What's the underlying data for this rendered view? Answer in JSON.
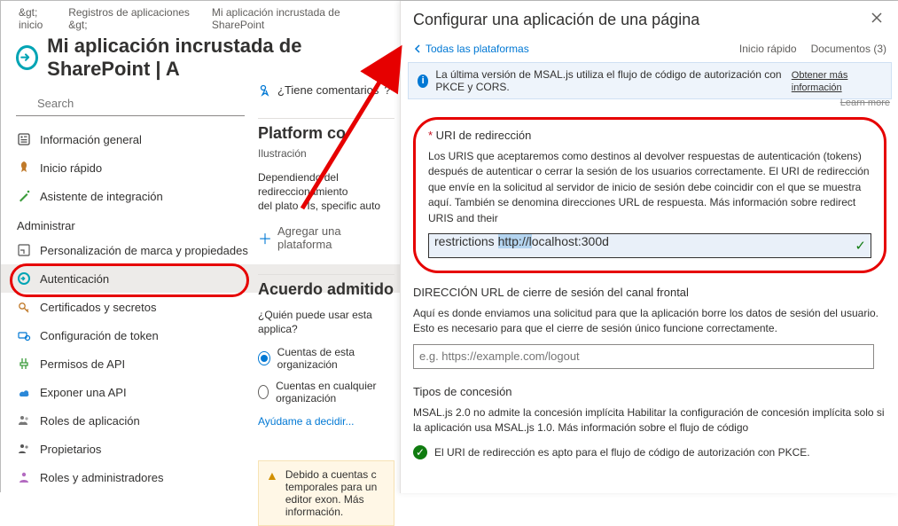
{
  "breadcrumb": {
    "item1": "&gt; inicio",
    "item2": "Registros de aplicaciones &gt;",
    "item3": "Mi aplicación incrustada de SharePoint"
  },
  "page_title": "Mi aplicación incrustada de SharePoint | A",
  "search_placeholder": "Search",
  "nav": {
    "manage_label": "Administrar",
    "items": [
      {
        "label": "Información general"
      },
      {
        "label": "Inicio rápido"
      },
      {
        "label": "Asistente de integración"
      }
    ],
    "manage_items": [
      {
        "label": "Personalización de marca y propiedades"
      },
      {
        "label": "Autenticación"
      },
      {
        "label": "Certificados y secretos"
      },
      {
        "label": "Configuración de token"
      },
      {
        "label": "Permisos de API"
      },
      {
        "label": "Exponer una API"
      },
      {
        "label": "Roles de aplicación"
      },
      {
        "label": "Propietarios"
      },
      {
        "label": "Roles y administradores"
      }
    ]
  },
  "mid": {
    "feedback": "¿Tiene comentarios",
    "illustration": "Ilustración",
    "platform_title": "Platform co",
    "platform_desc1": "Dependiendo del redireccionamiento",
    "platform_desc2": "del plato",
    "platform_desc3": "Is, specific auto",
    "add_platform": "Agregar una plataforma",
    "agreement_title": "Acuerdo admitido",
    "agreement_who": "¿Quién puede usar esta applica?",
    "radio1": "Cuentas de esta organización",
    "radio2": "Cuentas en cualquier organización",
    "help": "Ayúdame a decidir...",
    "warning": "Debido a cuentas c temporales para un editor exon. Más información."
  },
  "flyout": {
    "title": "Configurar una aplicación de una página",
    "back": "Todas las plataformas",
    "quickstart": "Inicio rápido",
    "docs": "Documentos",
    "docs_count": "(3)",
    "info_text": "La última versión de MSAL.js utiliza el flujo de código de autorización con PKCE y CORS.",
    "info_link": "Obtener más información",
    "info_link2": "Learn more",
    "uri_label": "URI de redirección",
    "uri_desc": "Los URIS que aceptaremos como destinos al devolver respuestas de autenticación (tokens) después de autenticar o cerrar la sesión de los usuarios correctamente. El URI de redirección que envíe en la solicitud al servidor de inicio de sesión debe coincidir con el que se muestra aquí. También se denomina direcciones URL de respuesta. Más información sobre redirect URIS and their",
    "uri_value_prefix": "restrictions ",
    "uri_value_selected": "http://l",
    "uri_value_rest": "ocalhost:300d",
    "logout_label": "DIRECCIÓN URL de cierre de sesión del canal frontal",
    "logout_desc": "Aquí es donde enviamos una solicitud para que la aplicación borre los datos de sesión del usuario. Esto es necesario para que el cierre de sesión único funcione correctamente.",
    "logout_placeholder": "e.g. https://example.com/logout",
    "grant_label": "Tipos de concesión",
    "grant_desc": "MSAL.js 2.0 no admite la concesión implícita Habilitar la configuración de concesión implícita solo si la aplicación usa MSAL.js 1.0. Más información sobre el flujo de código",
    "success": "El URI de redirección es apto para el flujo de código de autorización con PKCE."
  }
}
